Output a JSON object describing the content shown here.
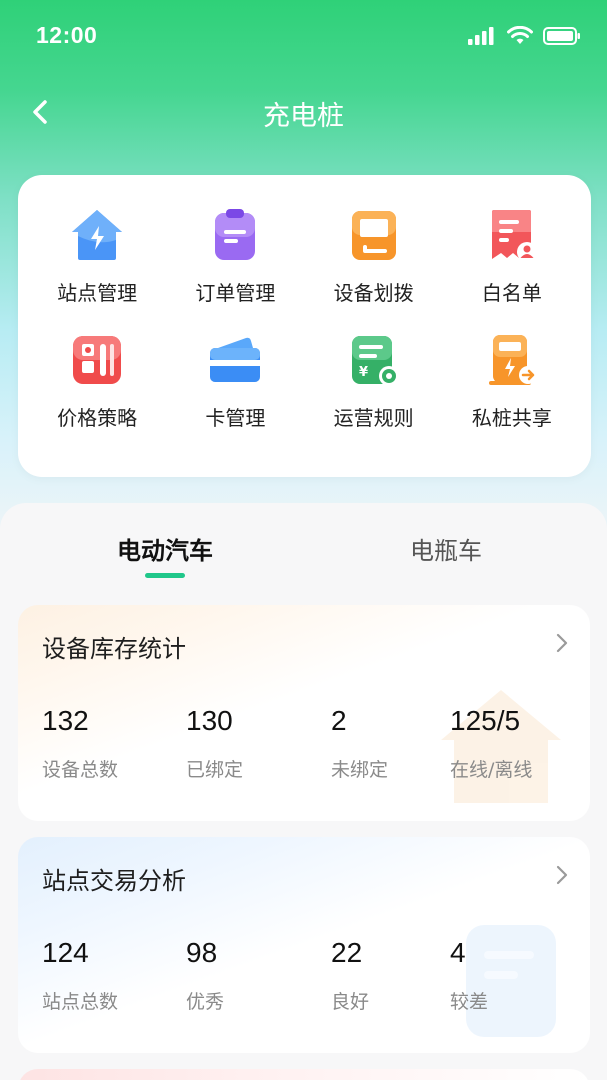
{
  "status_bar": {
    "time": "12:00"
  },
  "nav": {
    "title": "充电桩"
  },
  "menu": {
    "items": [
      {
        "label": "站点管理",
        "icon": "station-house-icon",
        "color": "#3f8bf5"
      },
      {
        "label": "订单管理",
        "icon": "order-clipboard-icon",
        "color": "#8a5cf0"
      },
      {
        "label": "设备划拨",
        "icon": "device-transfer-icon",
        "color": "#f79a2a"
      },
      {
        "label": "白名单",
        "icon": "whitelist-icon",
        "color": "#f0554f"
      },
      {
        "label": "价格策略",
        "icon": "price-strategy-icon",
        "color": "#f04c4c"
      },
      {
        "label": "卡管理",
        "icon": "card-icon",
        "color": "#3f8bf5"
      },
      {
        "label": "运营规则",
        "icon": "operation-rule-icon",
        "color": "#37b46a"
      },
      {
        "label": "私桩共享",
        "icon": "private-pile-share-icon",
        "color": "#f79a2a"
      }
    ]
  },
  "tabs": {
    "active": "电动汽车",
    "inactive": "电瓶车",
    "accent": "#20c78a"
  },
  "inventory": {
    "title": "设备库存统计",
    "stats": [
      {
        "value": "132",
        "label": "设备总数"
      },
      {
        "value": "130",
        "label": "已绑定"
      },
      {
        "value": "2",
        "label": "未绑定"
      },
      {
        "value": "125/5",
        "label": "在线/离线"
      }
    ]
  },
  "transactions": {
    "title": "站点交易分析",
    "stats": [
      {
        "value": "124",
        "label": "站点总数"
      },
      {
        "value": "98",
        "label": "优秀"
      },
      {
        "value": "22",
        "label": "良好"
      },
      {
        "value": "4",
        "label": "较差"
      }
    ]
  }
}
